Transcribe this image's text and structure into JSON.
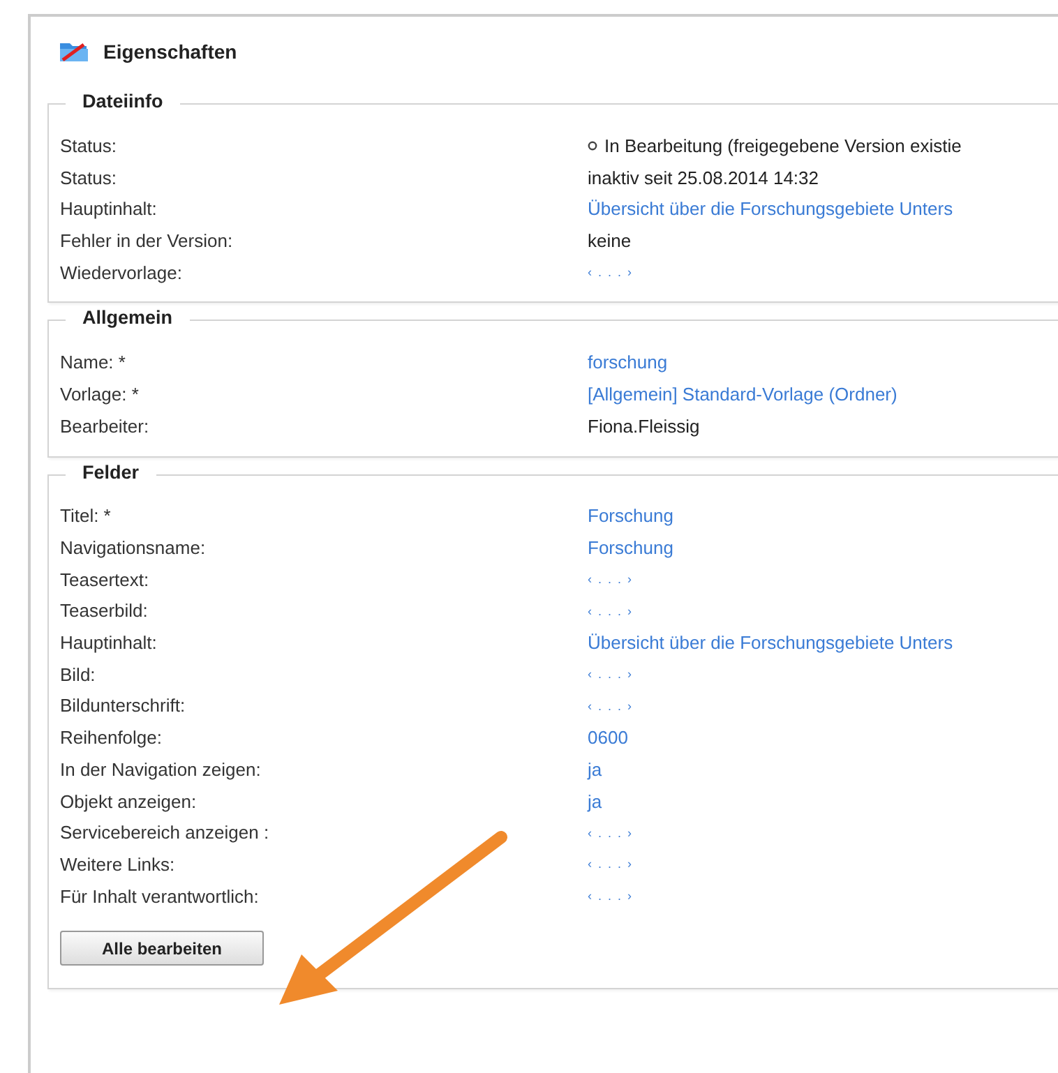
{
  "panel": {
    "title": "Eigenschaften"
  },
  "sections": [
    {
      "legend": "Dateiinfo",
      "rows": [
        {
          "label": "Status:",
          "value": "In Bearbeitung (freigegebene Version existie",
          "kind": "status"
        },
        {
          "label": "Status:",
          "value": "inaktiv seit 25.08.2014 14:32",
          "kind": "text"
        },
        {
          "label": "Hauptinhalt:",
          "value": "Übersicht über die Forschungsgebiete Unters",
          "kind": "link"
        },
        {
          "label": "Fehler in der Version:",
          "value": "keine",
          "kind": "text"
        },
        {
          "label": "Wiedervorlage:",
          "value": "‹ . . . ›",
          "kind": "empty"
        }
      ]
    },
    {
      "legend": "Allgemein",
      "rows": [
        {
          "label": "Name: *",
          "value": "forschung",
          "kind": "link"
        },
        {
          "label": "Vorlage: *",
          "value": "[Allgemein] Standard-Vorlage (Ordner)",
          "kind": "link"
        },
        {
          "label": "Bearbeiter:",
          "value": "Fiona.Fleissig",
          "kind": "text"
        }
      ]
    },
    {
      "legend": "Felder",
      "rows": [
        {
          "label": "Titel: *",
          "value": "Forschung",
          "kind": "link"
        },
        {
          "label": "Navigationsname:",
          "value": "Forschung",
          "kind": "link"
        },
        {
          "label": "Teasertext:",
          "value": "‹ . . . ›",
          "kind": "empty"
        },
        {
          "label": "Teaserbild:",
          "value": "‹ . . . ›",
          "kind": "empty"
        },
        {
          "label": "Hauptinhalt:",
          "value": "Übersicht über die Forschungsgebiete Unters",
          "kind": "link"
        },
        {
          "label": "Bild:",
          "value": "‹ . . . ›",
          "kind": "empty"
        },
        {
          "label": "Bildunterschrift:",
          "value": "‹ . . . ›",
          "kind": "empty"
        },
        {
          "label": "Reihenfolge:",
          "value": "0600",
          "kind": "link"
        },
        {
          "label": "In der Navigation zeigen:",
          "value": "ja",
          "kind": "link"
        },
        {
          "label": "Objekt anzeigen:",
          "value": "ja",
          "kind": "link"
        },
        {
          "label": "Servicebereich anzeigen :",
          "value": "‹ . . . ›",
          "kind": "empty"
        },
        {
          "label": "Weitere Links:",
          "value": "‹ . . . ›",
          "kind": "empty"
        },
        {
          "label": "Für Inhalt verantwortlich:",
          "value": "‹ . . . ›",
          "kind": "empty"
        }
      ],
      "button": "Alle bearbeiten"
    }
  ]
}
